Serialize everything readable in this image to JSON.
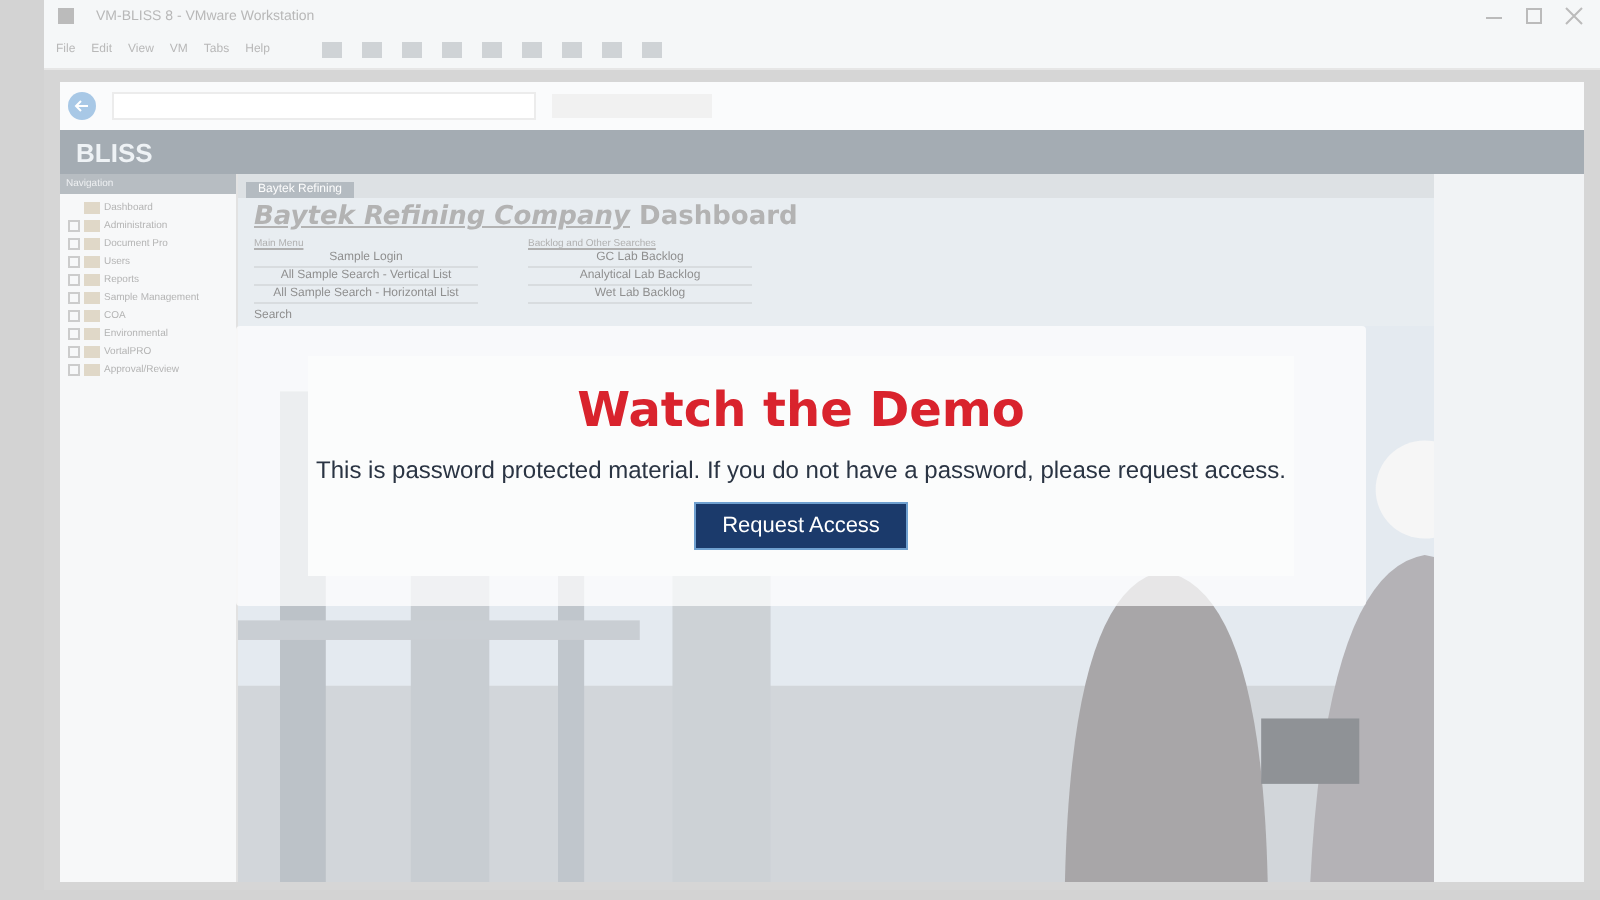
{
  "window": {
    "title": "VM-BLISS 8 - VMware Workstation"
  },
  "menu": [
    "File",
    "Edit",
    "View",
    "VM",
    "Tabs",
    "Help"
  ],
  "app": {
    "logo": "BLISS",
    "navigation_title": "Navigation",
    "tab": "Baytek Refining"
  },
  "tree": [
    {
      "label": "Dashboard",
      "kind": "page"
    },
    {
      "label": "Administration",
      "kind": "group"
    },
    {
      "label": "Document Pro",
      "kind": "group"
    },
    {
      "label": "Users",
      "kind": "group"
    },
    {
      "label": "Reports",
      "kind": "group"
    },
    {
      "label": "Sample Management",
      "kind": "group"
    },
    {
      "label": "COA",
      "kind": "group"
    },
    {
      "label": "Environmental",
      "kind": "group"
    },
    {
      "label": "VortalPRO",
      "kind": "group"
    },
    {
      "label": "Approval/Review",
      "kind": "group"
    }
  ],
  "dashboard": {
    "title_link": "Baytek Refining Company",
    "title_rest": "Dashboard",
    "search_label": "Search",
    "sections": [
      {
        "heading": "Main Menu",
        "buttons": [
          "Sample Login",
          "All Sample Search - Vertical List",
          "All Sample Search - Horizontal List"
        ]
      },
      {
        "heading": "Backlog and Other Searches",
        "buttons": [
          "GC Lab Backlog",
          "Analytical Lab Backlog",
          "Wet Lab Backlog"
        ]
      }
    ]
  },
  "modal": {
    "title": "Watch the Demo",
    "message": "This is password protected material. If you do not have a password, please request access.",
    "button": "Request Access"
  }
}
